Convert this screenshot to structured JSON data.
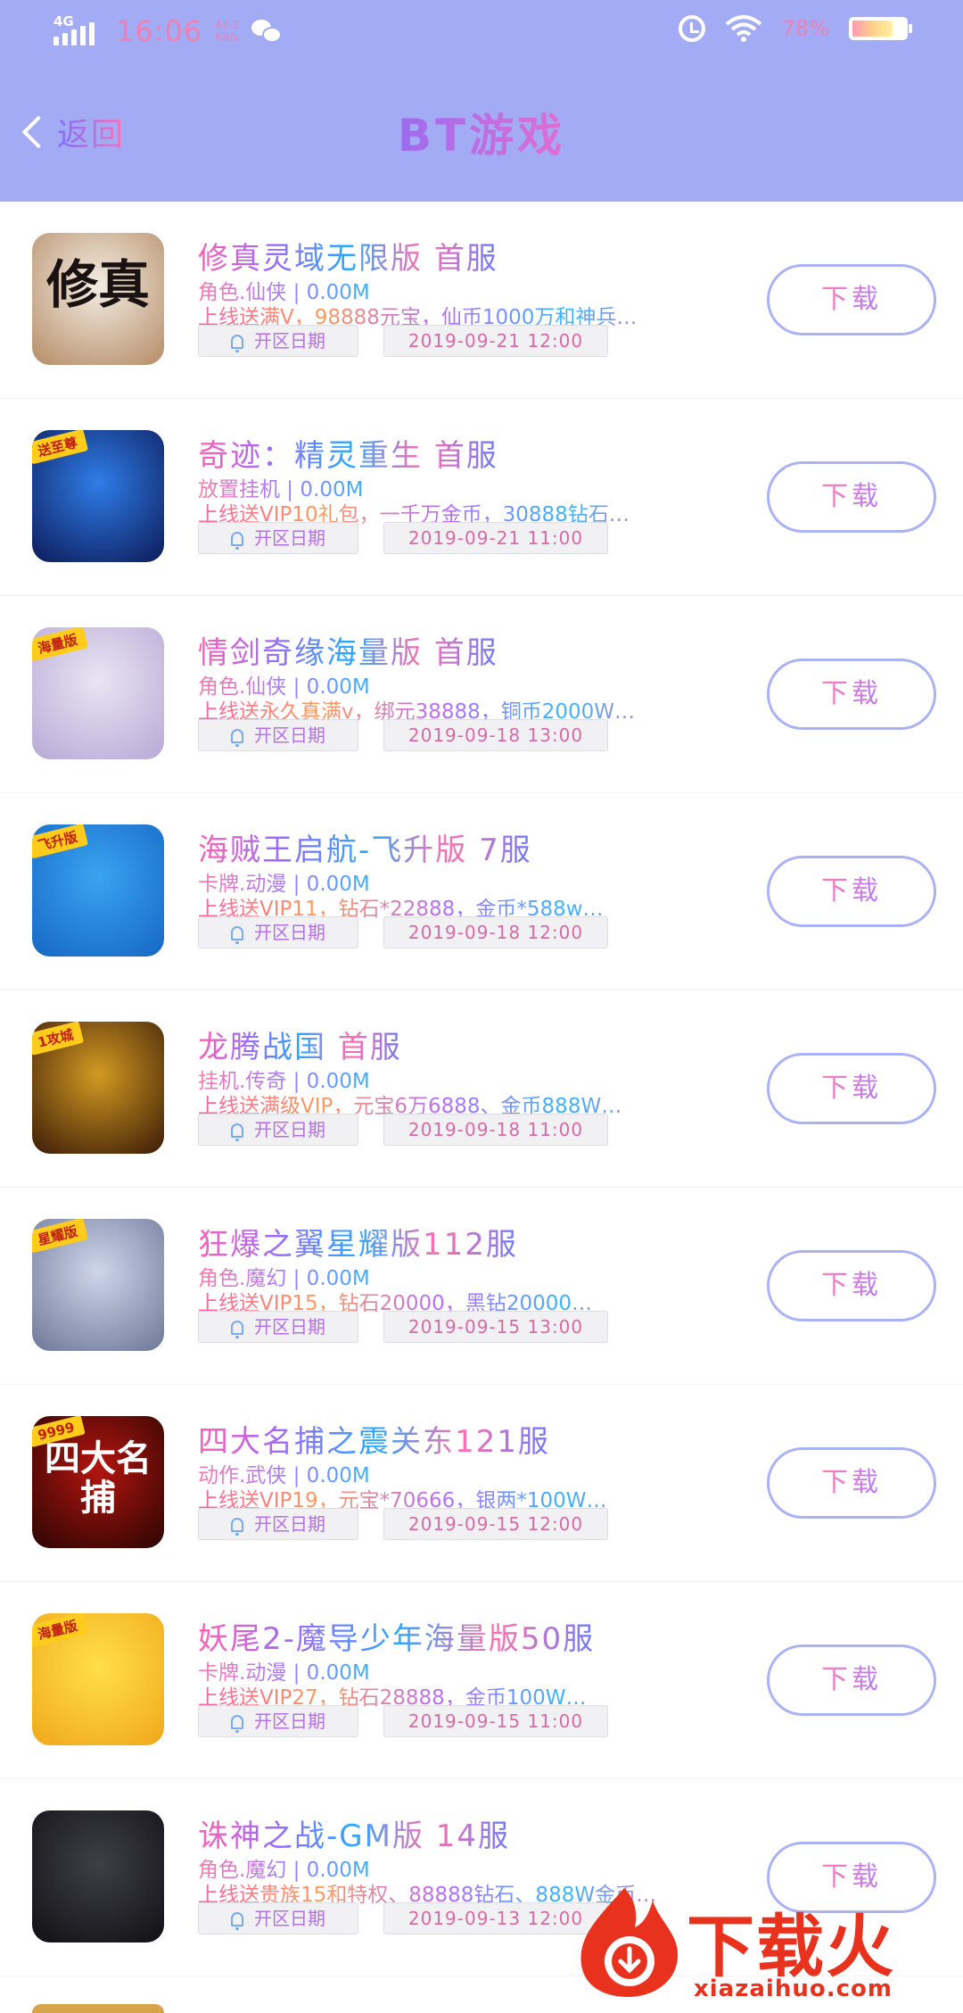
{
  "status_bar": {
    "network": "4G",
    "time": "16:06",
    "speed_value": "47.2",
    "speed_unit": "KB/s",
    "battery_percent": "78%",
    "battery_level": 0.78
  },
  "header": {
    "back_label": "返回",
    "title": "BT游戏"
  },
  "games": [
    {
      "name": "修真灵域无限版 首服",
      "meta": "角色.仙侠 | 0.00M",
      "desc": "上线送满V，98888元宝，仙币1000万和神兵…",
      "open_label": "开区日期",
      "date": "2019-09-21 12:00",
      "download": "下载",
      "icon_text": "修真",
      "icon_tag": "",
      "icon_colors": [
        "#f3ece3",
        "#b58c66"
      ]
    },
    {
      "name": "奇迹：精灵重生 首服",
      "meta": "放置挂机 | 0.00M",
      "desc": "上线送VIP10礼包，一千万金币，30888钻石…",
      "open_label": "开区日期",
      "date": "2019-09-21 11:00",
      "download": "下载",
      "icon_text": "",
      "icon_tag": "送至尊",
      "icon_colors": [
        "#2f7de8",
        "#0d1b59"
      ]
    },
    {
      "name": "情剑奇缘海量版 首服",
      "meta": "角色.仙侠 | 0.00M",
      "desc": "上线送永久真满v，绑元38888，铜币2000W…",
      "open_label": "开区日期",
      "date": "2019-09-18 13:00",
      "download": "下载",
      "icon_text": "",
      "icon_tag": "海量版",
      "icon_colors": [
        "#e9e4f3",
        "#b8a9d6"
      ]
    },
    {
      "name": "海贼王启航-飞升版 7服",
      "meta": "卡牌.动漫 | 0.00M",
      "desc": "上线送VIP11，钻石*22888，金币*588w…",
      "open_label": "开区日期",
      "date": "2019-09-18 12:00",
      "download": "下载",
      "icon_text": "",
      "icon_tag": "飞升版",
      "icon_colors": [
        "#3aa3f0",
        "#1668c4"
      ]
    },
    {
      "name": "龙腾战国 首服",
      "meta": "挂机.传奇 | 0.00M",
      "desc": "上线送满级VIP，元宝6万6888、金币888W…",
      "open_label": "开区日期",
      "date": "2019-09-18 11:00",
      "download": "下载",
      "icon_text": "",
      "icon_tag": "1攻城",
      "icon_colors": [
        "#d29a22",
        "#3b1b07"
      ]
    },
    {
      "name": "狂爆之翼星耀版112服",
      "meta": "角色.魔幻 | 0.00M",
      "desc": "上线送VIP15，钻石20000，黑钻20000…",
      "open_label": "开区日期",
      "date": "2019-09-15 13:00",
      "download": "下载",
      "icon_text": "",
      "icon_tag": "星耀版",
      "icon_colors": [
        "#cfd6ea",
        "#6d7797"
      ]
    },
    {
      "name": "四大名捕之震关东121服",
      "meta": "动作.武侠 | 0.00M",
      "desc": "上线送VIP19，元宝*70666，银两*100W…",
      "open_label": "开区日期",
      "date": "2019-09-15 12:00",
      "download": "下载",
      "icon_text": "四大名捕",
      "icon_tag": "9999",
      "icon_colors": [
        "#b3150f",
        "#2b0503"
      ]
    },
    {
      "name": "妖尾2-魔导少年海量版50服",
      "meta": "卡牌.动漫 | 0.00M",
      "desc": "上线送VIP27，钻石28888，金币100W…",
      "open_label": "开区日期",
      "date": "2019-09-15 11:00",
      "download": "下载",
      "icon_text": "",
      "icon_tag": "海量版",
      "icon_colors": [
        "#ffdf4a",
        "#f0a81a"
      ]
    },
    {
      "name": "诛神之战-GM版 14服",
      "meta": "角色.魔幻 | 0.00M",
      "desc": "上线送贵族15和特权、88888钻石、888W金币…",
      "open_label": "开区日期",
      "date": "2019-09-13 12:00",
      "download": "下载",
      "icon_text": "",
      "icon_tag": "",
      "icon_colors": [
        "#3f3f48",
        "#111114"
      ]
    }
  ],
  "watermark": {
    "brand": "下载火",
    "url": "xiazaihuo.com",
    "color": "#e8321e"
  }
}
